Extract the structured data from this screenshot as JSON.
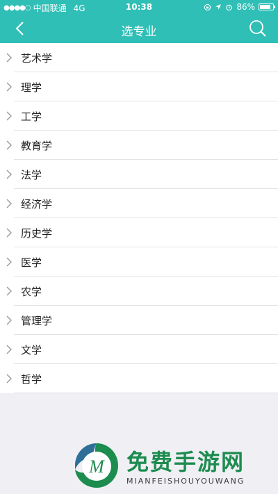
{
  "status_bar": {
    "signal_dots": "●●●●○",
    "carrier": "中国联通",
    "network": "4G",
    "time": "10:38",
    "battery": "86%",
    "battery_level": 0.86
  },
  "nav": {
    "title": "选专业",
    "back_icon": "chevron-left-icon",
    "search_icon": "search-icon"
  },
  "majors": [
    {
      "label": "艺术学"
    },
    {
      "label": "理学"
    },
    {
      "label": "工学"
    },
    {
      "label": "教育学"
    },
    {
      "label": "法学"
    },
    {
      "label": "经济学"
    },
    {
      "label": "历史学"
    },
    {
      "label": "医学"
    },
    {
      "label": "农学"
    },
    {
      "label": "管理学"
    },
    {
      "label": "文学"
    },
    {
      "label": "哲学"
    }
  ],
  "watermark": {
    "title": "免费手游网",
    "subtitle": "MIANFEISHOUYOUWANG",
    "logo_letter": "M"
  },
  "colors": {
    "accent": "#2fbfb6",
    "background": "#efeff4",
    "watermark_green": "#1d8c4f"
  }
}
